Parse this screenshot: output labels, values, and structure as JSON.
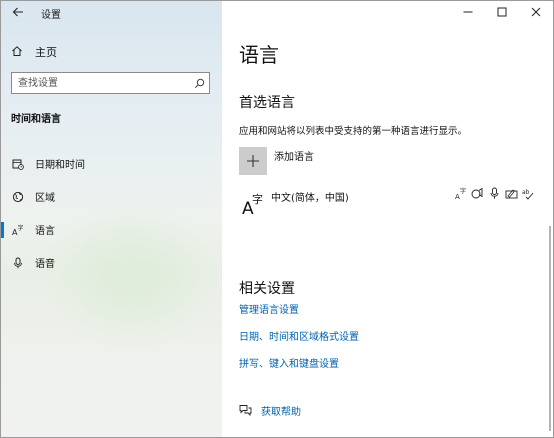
{
  "window": {
    "app_title": "设置"
  },
  "sidebar": {
    "home_label": "主页",
    "search_placeholder": "查找设置",
    "section_title": "时间和语言",
    "items": [
      {
        "label": "日期和时间",
        "icon": "calendar-clock-icon"
      },
      {
        "label": "区域",
        "icon": "globe-icon"
      },
      {
        "label": "语言",
        "icon": "language-icon",
        "active": true
      },
      {
        "label": "语音",
        "icon": "microphone-icon"
      }
    ]
  },
  "main": {
    "title": "语言",
    "preferred_heading": "首选语言",
    "preferred_desc": "应用和网站将以列表中受支持的第一种语言进行显示。",
    "add_language_label": "添加语言",
    "languages": [
      {
        "name": "中文(简体，中国)",
        "features": [
          "display-language-icon",
          "text-to-speech-icon",
          "speech-recognition-icon",
          "handwriting-icon",
          "spell-check-icon"
        ]
      }
    ],
    "related_heading": "相关设置",
    "related_links": [
      "管理语言设置",
      "日期、时间和区域格式设置",
      "拼写、键入和键盘设置"
    ],
    "help_label": "获取帮助"
  },
  "colors": {
    "accent": "#0078d7",
    "link": "#0063b1"
  }
}
